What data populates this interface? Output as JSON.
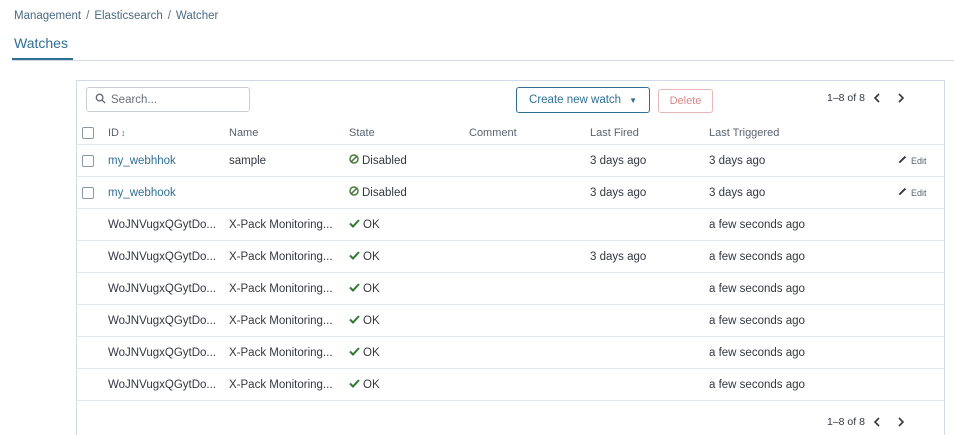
{
  "breadcrumb": {
    "items": [
      "Management",
      "Elasticsearch",
      "Watcher"
    ],
    "separator": "/"
  },
  "page_tab": "Watches",
  "toolbar": {
    "search_placeholder": "Search...",
    "create_label": "Create new watch",
    "delete_label": "Delete"
  },
  "pagination": {
    "top_range": "1–8 of 8",
    "bottom_range": "1–8 of 8"
  },
  "table": {
    "columns": {
      "id": "ID",
      "sort_indicator": "↕",
      "name": "Name",
      "state": "State",
      "comment": "Comment",
      "last_fired": "Last Fired",
      "last_triggered": "Last Triggered"
    },
    "edit_label": "Edit",
    "rows": [
      {
        "id": "my_webhhok",
        "name": "sample",
        "state": "Disabled",
        "comment": "",
        "last_fired": "3 days ago",
        "last_triggered": "3 days ago"
      },
      {
        "id": "my_webhook",
        "name": "",
        "state": "Disabled",
        "comment": "",
        "last_fired": "3 days ago",
        "last_triggered": "3 days ago"
      },
      {
        "id": "WoJNVugxQGytDo...",
        "name": "X-Pack Monitoring...",
        "state": "OK",
        "comment": "",
        "last_fired": "",
        "last_triggered": "a few seconds ago"
      },
      {
        "id": "WoJNVugxQGytDo...",
        "name": "X-Pack Monitoring...",
        "state": "OK",
        "comment": "",
        "last_fired": "3 days ago",
        "last_triggered": "a few seconds ago"
      },
      {
        "id": "WoJNVugxQGytDo...",
        "name": "X-Pack Monitoring...",
        "state": "OK",
        "comment": "",
        "last_fired": "",
        "last_triggered": "a few seconds ago"
      },
      {
        "id": "WoJNVugxQGytDo...",
        "name": "X-Pack Monitoring...",
        "state": "OK",
        "comment": "",
        "last_fired": "",
        "last_triggered": "a few seconds ago"
      },
      {
        "id": "WoJNVugxQGytDo...",
        "name": "X-Pack Monitoring...",
        "state": "OK",
        "comment": "",
        "last_fired": "",
        "last_triggered": "a few seconds ago"
      },
      {
        "id": "WoJNVugxQGytDo...",
        "name": "X-Pack Monitoring...",
        "state": "OK",
        "comment": "",
        "last_fired": "",
        "last_triggered": "a few seconds ago"
      }
    ]
  },
  "colors": {
    "accent": "#2f6f95",
    "ok": "#2e7d32",
    "disabled": "#4a7a3c",
    "delete": "#d68a8a",
    "border": "#d3dae6"
  },
  "icons": {
    "search": "search-icon",
    "caret": "chevron-down-icon",
    "prev": "chevron-left-icon",
    "next": "chevron-right-icon",
    "edit": "pencil-icon",
    "ok": "check-icon",
    "disabled": "disabled-circle-icon"
  }
}
